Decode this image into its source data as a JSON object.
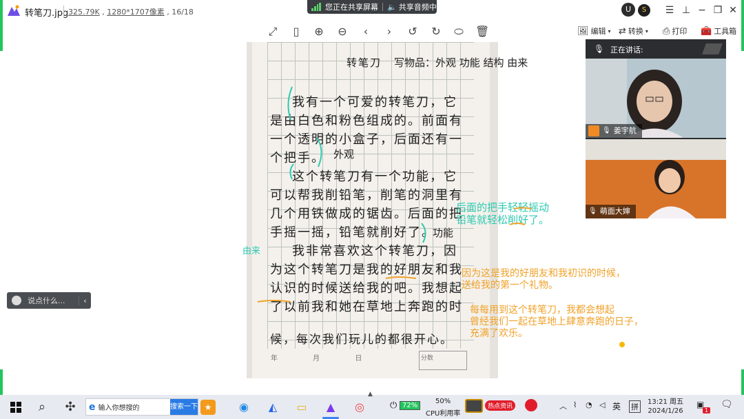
{
  "window": {
    "file_name": "转笔刀.jpg",
    "file_size": "325.79K",
    "dimensions": "1280*1707像素",
    "page_index": "16/18"
  },
  "share_banner": {
    "sharing_label": "您正在共享屏幕",
    "audio_label": "共享音频中"
  },
  "toolbar": {
    "right_tools": {
      "edit": "编辑",
      "convert": "转换",
      "print": "打印",
      "toolbox": "工具箱"
    }
  },
  "essay": {
    "title_line": "转笔刀",
    "lines": [
      "我有一个可爱的转笔刀，它",
      "是由白色和粉色组成的。前面有",
      "一个透明的小盒子，后面还有一",
      "个把手。",
      "这个转笔刀有一个功能，它",
      "可以帮我削铅笔，削笔的洞里有",
      "几个用铁做成的锯齿。后面的把",
      "手摇一摇，铅笔就削好了。",
      "我非常喜欢这个转笔刀，因",
      "为这个转笔刀是我的好朋友和我",
      "认识的时候送给我的吧。我想起",
      "了以前我和她在草地上奔跑的时",
      "候，每次我们玩儿的都很开心。"
    ],
    "footer": "年 月 日",
    "footer_box": "分数"
  },
  "annotations": {
    "heading": "写物品：外观  功能  结构  由来",
    "appearance": "外观",
    "function": "功能",
    "origin": "由来",
    "teal_note_1": "后面的把手轻轻摇动",
    "teal_note_2": "铅笔就轻松削好了。",
    "orange_note_1": "因为这是我的好朋友和我初识的时候，",
    "orange_note_2": "送给我的第一个礼物。",
    "orange_note_3": "每每用到这个转笔刀，我都会想起",
    "orange_note_4": "曾经我们一起在草地上肆意奔跑的日子，",
    "orange_note_5": "充满了欢乐。"
  },
  "video_panel": {
    "speaking_label": "正在讲话:",
    "participants": [
      {
        "name": "姜宇航"
      },
      {
        "name": "萌面大婶"
      }
    ]
  },
  "chat": {
    "placeholder": "说点什么..."
  },
  "taskbar": {
    "search_placeholder": "输入你想搜的",
    "search_button": "搜索一下",
    "battery": "72%",
    "cpu_percent": "50%",
    "cpu_label": "CPU利用率",
    "hot_news": "热点资讯",
    "ime": "英",
    "ime2": "拼",
    "time": "13:21 周五",
    "date": "2024/1/26",
    "notification_count": "1"
  },
  "colors": {
    "teal": "#2ec9b0",
    "orange": "#f0a22a",
    "share_green": "#22c55e",
    "video_bg": "#2b2d30"
  }
}
